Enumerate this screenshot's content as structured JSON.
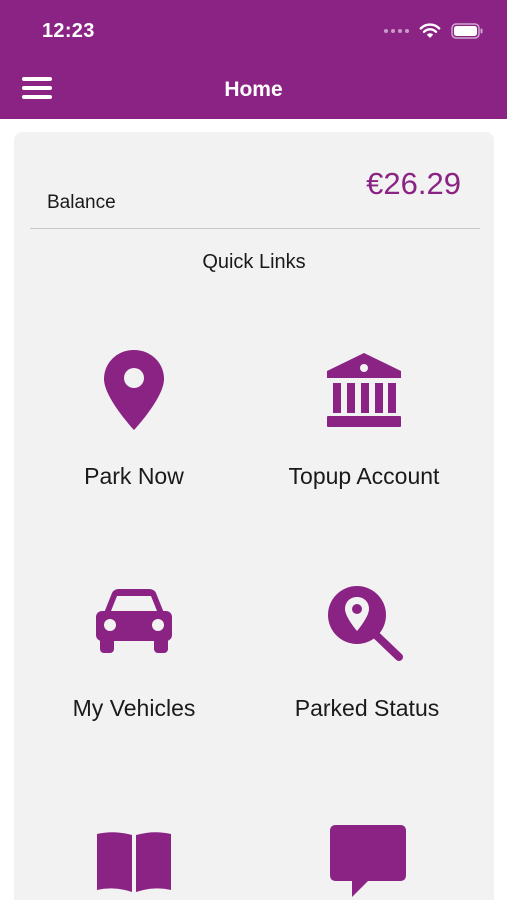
{
  "status_bar": {
    "time": "12:23"
  },
  "header": {
    "title": "Home"
  },
  "balance": {
    "label": "Balance",
    "value": "€26.29"
  },
  "quick_links": {
    "title": "Quick Links",
    "items": [
      {
        "label": "Park Now",
        "icon": "map-pin-icon"
      },
      {
        "label": "Topup Account",
        "icon": "bank-icon"
      },
      {
        "label": "My Vehicles",
        "icon": "car-icon"
      },
      {
        "label": "Parked Status",
        "icon": "location-search-icon"
      },
      {
        "label": "",
        "icon": "book-icon"
      },
      {
        "label": "",
        "icon": "chat-bubble-icon"
      }
    ]
  },
  "colors": {
    "primary": "#8a2384",
    "card_bg": "#f2f2f2"
  }
}
